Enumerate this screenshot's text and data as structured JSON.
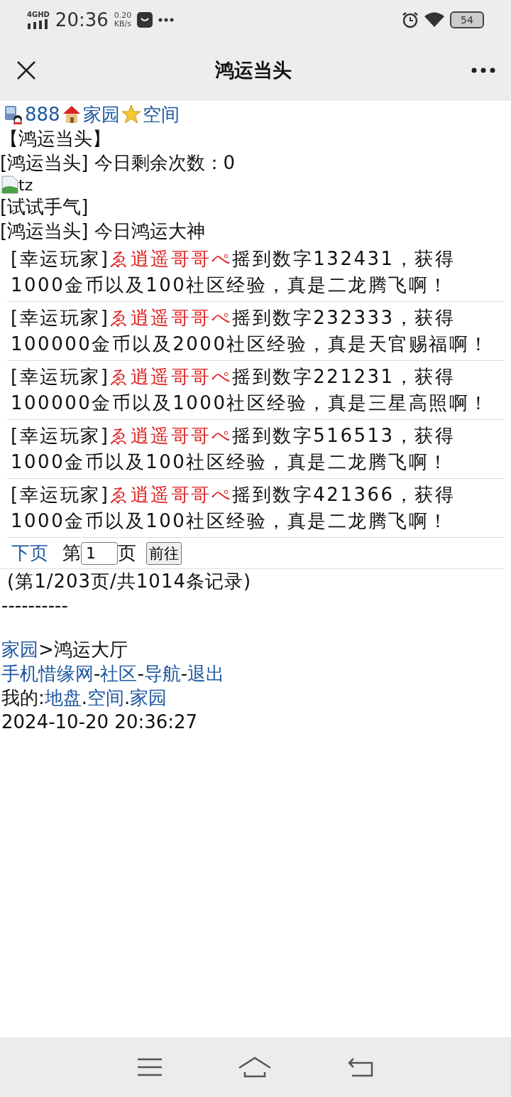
{
  "status_bar": {
    "network": "4GHD",
    "time": "20:36",
    "speed": "0.20",
    "speed_unit": "KB/s",
    "battery": "54"
  },
  "header": {
    "title": "鸿运当头"
  },
  "top_links": [
    {
      "kind": "qq",
      "text": "888"
    },
    {
      "kind": "house",
      "text": "家园"
    },
    {
      "kind": "star",
      "text": "空间"
    }
  ],
  "heading": "【鸿运当头】",
  "remaining": "[鸿运当头] 今日剩余次数：0",
  "broken_image_alt": "tz",
  "try_link": "[试试手气]",
  "winners_heading": "[鸿运当头] 今日鸿运大神",
  "records": [
    {
      "tag": "[幸运玩家]",
      "player": "ゑ逍遥哥哥ぺ",
      "text": "摇到数字132431，获得1000金币以及100社区经验，真是二龙腾飞啊！"
    },
    {
      "tag": "[幸运玩家]",
      "player": "ゑ逍遥哥哥ぺ",
      "text": "摇到数字232333，获得100000金币以及2000社区经验，真是天官赐福啊！"
    },
    {
      "tag": "[幸运玩家]",
      "player": "ゑ逍遥哥哥ぺ",
      "text": "摇到数字221231，获得100000金币以及1000社区经验，真是三星高照啊！"
    },
    {
      "tag": "[幸运玩家]",
      "player": "ゑ逍遥哥哥ぺ",
      "text": "摇到数字516513，获得1000金币以及100社区经验，真是二龙腾飞啊！"
    },
    {
      "tag": "[幸运玩家]",
      "player": "ゑ逍遥哥哥ぺ",
      "text": "摇到数字421366，获得1000金币以及100社区经验，真是二龙腾飞啊！"
    }
  ],
  "pager": {
    "next": "下页",
    "prefix": "第",
    "page": "1",
    "suffix": "页",
    "go": "前往",
    "summary": "(第1/203页/共1014条记录)"
  },
  "dashes": "----------",
  "breadcrumb": {
    "link": "家园",
    "rest": ">鸿运大厅"
  },
  "footer_links": {
    "separator": "-",
    "links": [
      "手机惜缘网",
      "社区",
      "导航",
      "退出"
    ]
  },
  "mine": {
    "label": "我的:",
    "separator": ".",
    "links": [
      "地盘",
      "空间",
      "家园"
    ]
  },
  "timestamp": "2024-10-20 20:36:27"
}
